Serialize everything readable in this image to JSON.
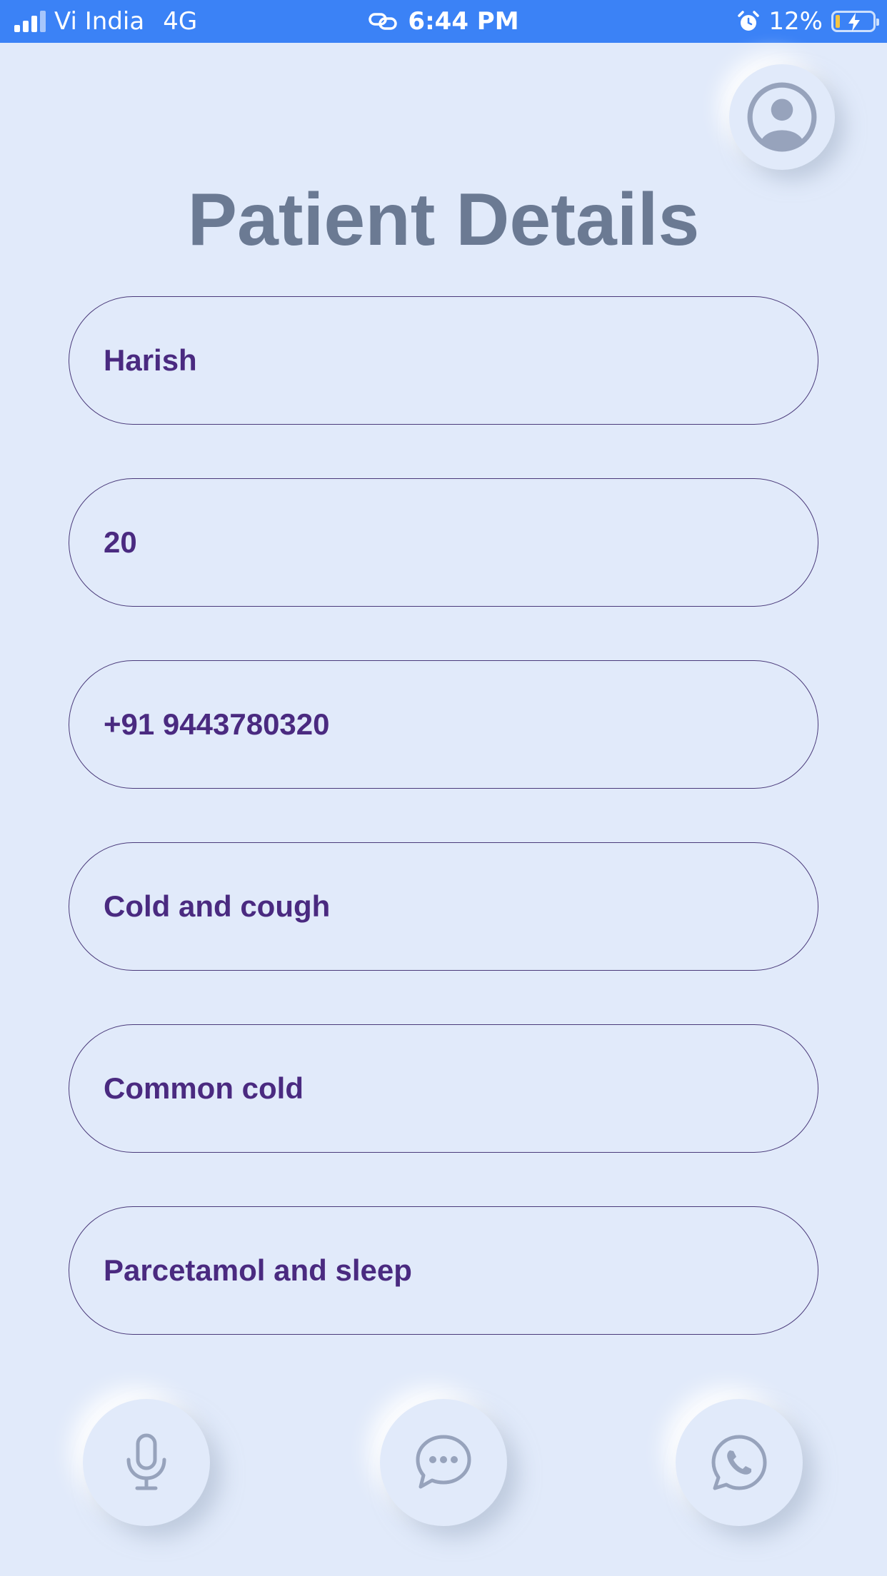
{
  "status_bar": {
    "carrier": "Vi India",
    "network": "4G",
    "time": "6:44 PM",
    "battery_percent": "12%",
    "battery_level": 0.12
  },
  "header": {
    "title": "Patient Details",
    "avatar_icon": "user-circle-icon"
  },
  "fields": [
    {
      "value": "Harish"
    },
    {
      "value": "20"
    },
    {
      "value": "+91 9443780320"
    },
    {
      "value": "Cold and cough"
    },
    {
      "value": "Common cold"
    },
    {
      "value": "Parcetamol and sleep"
    }
  ],
  "actions": {
    "mic_icon": "microphone-icon",
    "chat_icon": "chat-bubble-icon",
    "whatsapp_icon": "whatsapp-icon"
  },
  "colors": {
    "background": "#e1eafa",
    "status_bar": "#3b82f6",
    "title": "#6b7a93",
    "field_text": "#4a2a80",
    "field_border": "#4a3a7a",
    "icon": "#97a3bc",
    "battery_fill": "#f5c542"
  }
}
